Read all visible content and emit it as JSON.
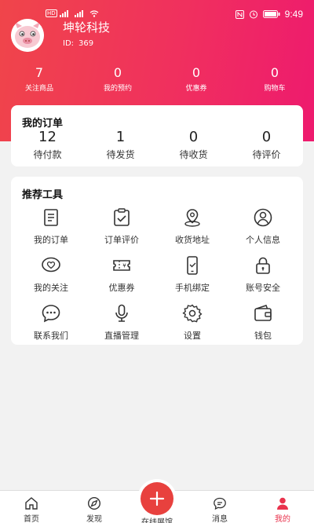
{
  "status_bar": {
    "left_badge": "HD",
    "time": "9:49"
  },
  "profile": {
    "name": "坤轮科技",
    "id_label": "ID:",
    "id_value": "369"
  },
  "stats": [
    {
      "value": "7",
      "label": "关注商品"
    },
    {
      "value": "0",
      "label": "我的预约"
    },
    {
      "value": "0",
      "label": "优惠券"
    },
    {
      "value": "0",
      "label": "购物车"
    }
  ],
  "orders": {
    "title": "我的订单",
    "items": [
      {
        "value": "12",
        "label": "待付款"
      },
      {
        "value": "1",
        "label": "待发货"
      },
      {
        "value": "0",
        "label": "待收货"
      },
      {
        "value": "0",
        "label": "待评价"
      }
    ]
  },
  "tools": {
    "title": "推荐工具",
    "items": [
      {
        "label": "我的订单",
        "icon": "order-list-icon"
      },
      {
        "label": "订单评价",
        "icon": "clipboard-check-icon"
      },
      {
        "label": "收货地址",
        "icon": "location-pin-icon"
      },
      {
        "label": "个人信息",
        "icon": "user-circle-icon"
      },
      {
        "label": "我的关注",
        "icon": "heart-chat-icon"
      },
      {
        "label": "优惠券",
        "icon": "coupon-icon"
      },
      {
        "label": "手机绑定",
        "icon": "phone-icon"
      },
      {
        "label": "账号安全",
        "icon": "lock-icon"
      },
      {
        "label": "联系我们",
        "icon": "chat-bubble-icon"
      },
      {
        "label": "直播管理",
        "icon": "microphone-icon"
      },
      {
        "label": "设置",
        "icon": "gear-icon"
      },
      {
        "label": "钱包",
        "icon": "wallet-icon"
      }
    ]
  },
  "bottom_nav": [
    {
      "label": "首页",
      "icon": "home-icon"
    },
    {
      "label": "发现",
      "icon": "discover-icon"
    },
    {
      "label": "在线展馆",
      "icon": "plus-icon"
    },
    {
      "label": "消息",
      "icon": "message-icon"
    },
    {
      "label": "我的",
      "icon": "user-icon",
      "active": true
    }
  ],
  "colors": {
    "accent": "#e9334d",
    "header_start": "#f0454a",
    "header_end": "#ee1a6e"
  }
}
